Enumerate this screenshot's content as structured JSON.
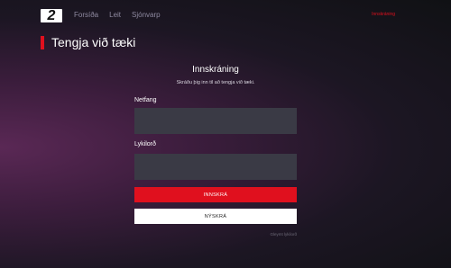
{
  "header": {
    "logo_text": "2",
    "nav": [
      {
        "label": "Forsíða"
      },
      {
        "label": "Leit"
      },
      {
        "label": "Sjónvarp"
      }
    ],
    "login_link": "Innskráning"
  },
  "page": {
    "title": "Tengja við tæki"
  },
  "form": {
    "heading": "Innskráning",
    "subheading": "Skráðu þig inn til að tengja við tæki.",
    "email_label": "Netfang",
    "email_value": "",
    "password_label": "Lykilorð",
    "password_value": "",
    "login_button": "INNSKRÁ",
    "register_button": "NÝSKRÁ",
    "forgot_link": "Gleymt lykilorð"
  },
  "colors": {
    "accent": "#e0101e",
    "input_bg": "#3a3a45",
    "background_dark": "#101114",
    "background_purple": "#5a2855"
  }
}
